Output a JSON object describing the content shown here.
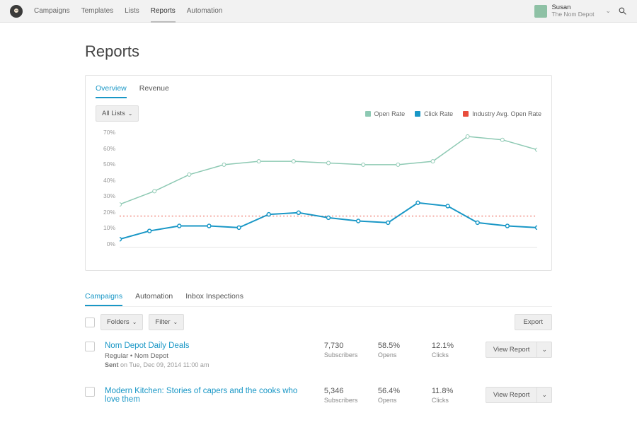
{
  "nav": [
    "Campaigns",
    "Templates",
    "Lists",
    "Reports",
    "Automation"
  ],
  "nav_active": 3,
  "user": {
    "name": "Susan",
    "org": "The Nom Depot"
  },
  "page_title": "Reports",
  "card_tabs": [
    "Overview",
    "Revenue"
  ],
  "card_tab_active": 0,
  "dropdown_label": "All Lists",
  "legend": [
    {
      "label": "Open Rate",
      "color": "#8dc9b3"
    },
    {
      "label": "Click Rate",
      "color": "#1997c6"
    },
    {
      "label": "Industry Avg. Open Rate",
      "color": "#e84d3d"
    }
  ],
  "chart_data": {
    "type": "line",
    "ylabel": "",
    "xlabel": "",
    "ylim": [
      0,
      70
    ],
    "y_ticks": [
      "70%",
      "60%",
      "50%",
      "40%",
      "30%",
      "20%",
      "10%",
      "0%"
    ],
    "x_count": 13,
    "series": [
      {
        "name": "Open Rate",
        "values": [
          26,
          34,
          44,
          50,
          52,
          52,
          51,
          50,
          50,
          52,
          67,
          65,
          59
        ]
      },
      {
        "name": "Click Rate",
        "values": [
          5,
          10,
          13,
          13,
          12,
          20,
          21,
          18,
          16,
          15,
          27,
          25,
          15,
          13,
          12
        ]
      },
      {
        "name": "Industry Avg. Open Rate",
        "values": [
          19,
          19,
          19,
          19,
          19,
          19,
          19,
          19,
          19,
          19,
          19,
          19,
          19
        ]
      }
    ]
  },
  "list_tabs": [
    "Campaigns",
    "Automation",
    "Inbox Inspections"
  ],
  "list_tab_active": 0,
  "toolbar": {
    "folders": "Folders",
    "filter": "Filter",
    "export": "Export"
  },
  "view_report_label": "View Report",
  "rows": [
    {
      "title": "Nom Depot Daily Deals",
      "sub": "Regular • Nom Depot",
      "sent_prefix": "Sent",
      "sent": " on Tue, Dec 09, 2014 11:00 am",
      "subscribers": "7,730",
      "opens": "58.5%",
      "clicks": "12.1%"
    },
    {
      "title": "Modern Kitchen: Stories of capers and the cooks who love them",
      "sub": "",
      "sent_prefix": "",
      "sent": "",
      "subscribers": "5,346",
      "opens": "56.4%",
      "clicks": "11.8%"
    }
  ],
  "metric_labels": {
    "subs": "Subscribers",
    "opens": "Opens",
    "clicks": "Clicks"
  }
}
